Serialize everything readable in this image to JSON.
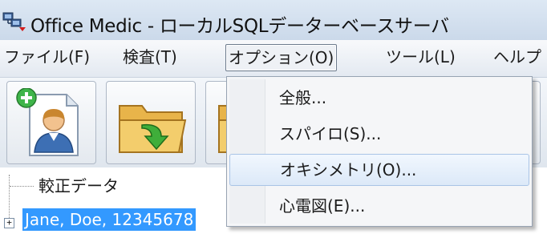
{
  "window": {
    "title": "Office Medic - ローカルSQLデーターベースサーバ",
    "icon": "app-network-icon"
  },
  "menubar": {
    "items": [
      {
        "label": "ファイル(F)"
      },
      {
        "label": "検査(T)"
      },
      {
        "label": "オプション(O)"
      },
      {
        "label": "ツール(L)"
      },
      {
        "label": "ヘルプ"
      }
    ],
    "open_index": 2
  },
  "toolbar": {
    "buttons": [
      {
        "icon": "add-patient-icon"
      },
      {
        "icon": "open-folder-icon"
      },
      {
        "icon": "folder-icon"
      },
      {
        "icon": "pencil-icon"
      }
    ]
  },
  "dropdown": {
    "items": [
      {
        "label": "全般..."
      },
      {
        "label": "スパイロ(S)..."
      },
      {
        "label": "オキシメトリ(O)..."
      },
      {
        "label": "心電図(E)..."
      }
    ],
    "hover_index": 2
  },
  "tree": {
    "items": [
      {
        "label": "較正データ",
        "expander": ""
      },
      {
        "label": "Jane, Doe, 12345678",
        "expander": "+"
      }
    ],
    "selected_index": 1
  },
  "colors": {
    "selection": "#3399ff",
    "titlebar": "#cbd9ea",
    "menu_hover": "#dce9f8"
  }
}
